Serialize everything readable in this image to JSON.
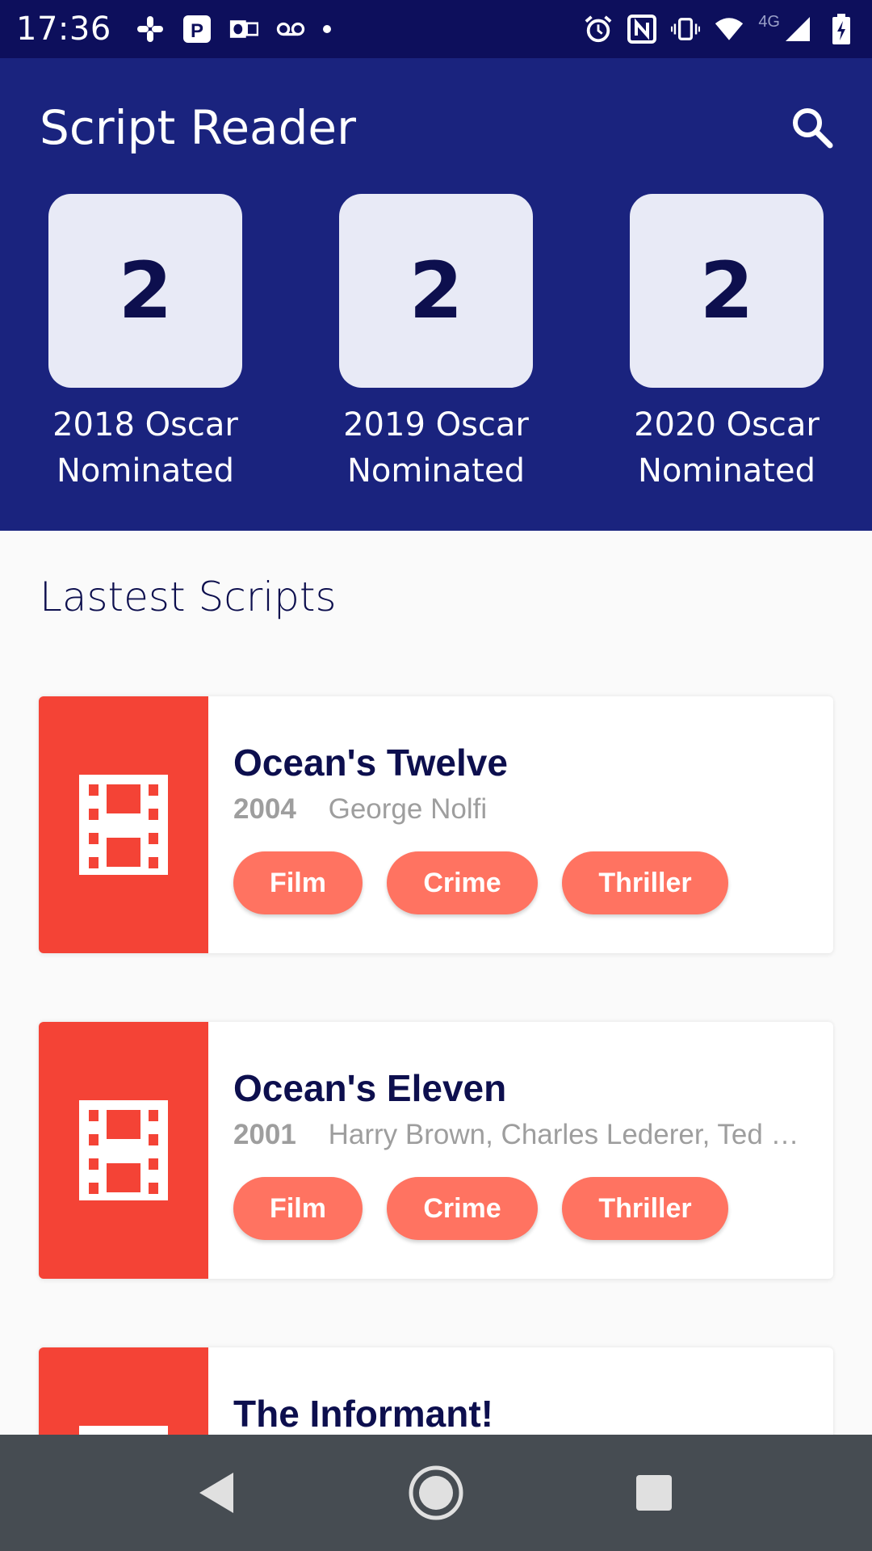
{
  "status_bar": {
    "time": "17:36",
    "left_icons": [
      "slack-icon",
      "parking-icon",
      "outlook-icon",
      "voicemail-icon",
      "dot-icon"
    ],
    "right_icons": [
      "alarm-icon",
      "nfc-icon",
      "vibrate-icon",
      "wifi-icon",
      "cell-signal-icon",
      "battery-icon"
    ],
    "network_label": "4G"
  },
  "header": {
    "title": "Script Reader",
    "search_icon": "search-icon",
    "color": "#1a237e"
  },
  "stats": [
    {
      "value": "2",
      "label_line1": "2018 Oscar",
      "label_line2": "Nominated"
    },
    {
      "value": "2",
      "label_line1": "2019 Oscar",
      "label_line2": "Nominated"
    },
    {
      "value": "2",
      "label_line1": "2020 Oscar",
      "label_line2": "Nominated"
    }
  ],
  "section": {
    "title": "Lastest Scripts"
  },
  "scripts": [
    {
      "title": "Ocean's Twelve",
      "year": "2004",
      "writers": "George Nolfi",
      "tags": [
        "Film",
        "Crime",
        "Thriller"
      ],
      "icon": "film-icon"
    },
    {
      "title": "Ocean's Eleven",
      "year": "2001",
      "writers": "Harry Brown, Charles Lederer, Ted G...",
      "tags": [
        "Film",
        "Crime",
        "Thriller"
      ],
      "icon": "film-icon"
    },
    {
      "title": "The Informant!",
      "icon": "film-icon"
    }
  ],
  "colors": {
    "accent": "#f44336",
    "tag": "#ff7361",
    "text_dark": "#0d0f4e"
  },
  "nav": {
    "buttons": [
      "back-icon",
      "home-icon",
      "recents-icon"
    ]
  }
}
